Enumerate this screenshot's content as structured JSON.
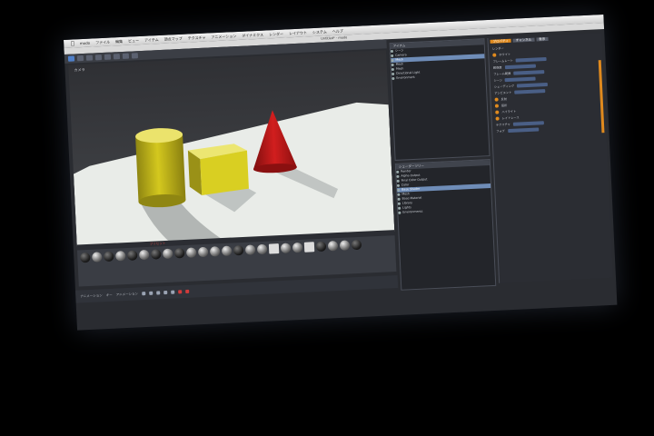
{
  "menubar": {
    "apple": "",
    "app": "modo",
    "items": [
      "ファイル",
      "編集",
      "ビュー",
      "アイテム",
      "頂点マップ",
      "テクスチャ",
      "アニメーション",
      "ダイナミクス",
      "レンダー",
      "レイアウト",
      "システム",
      "ヘルプ"
    ]
  },
  "window": {
    "title": "Untitled* - modo"
  },
  "viewport": {
    "label": "カメラ"
  },
  "shapes": {
    "cylinder": "#d4c81e",
    "cube": "#d9cf22",
    "cone": "#d11e1e",
    "floor": "#e9ece8"
  },
  "strip_tab": {
    "label": "プリセット"
  },
  "timeline": {
    "labels": [
      "アニメーション",
      "キー",
      "アニメーション"
    ]
  },
  "outliner": {
    "header": "アイテム",
    "rows": [
      "シーン",
      "Camera",
      "Mesh",
      "Mesh",
      "Mesh",
      "Directional Light",
      "Environment"
    ],
    "selected_index": 2
  },
  "shader": {
    "header": "シェーダーツリー",
    "rows": [
      "Render",
      "Alpha Output",
      "Final Color Output",
      "Color",
      "Base Shader",
      "Mesh",
      "Base Material",
      "Library",
      "Lights",
      "Environments"
    ],
    "selected_index": 4
  },
  "props": {
    "tabs": [
      "プロパティ",
      "チャンネル",
      "表示"
    ],
    "active_tab": 0,
    "rows": [
      "レンダー",
      "ホワイト",
      "フレームレート",
      "解像度",
      "フレーム範囲",
      "シーン",
      "シェーディング",
      "アンビエント",
      "反射",
      "屈折",
      "ハイライト",
      "レイトレース",
      "テクスチャ",
      "フォグ"
    ]
  }
}
